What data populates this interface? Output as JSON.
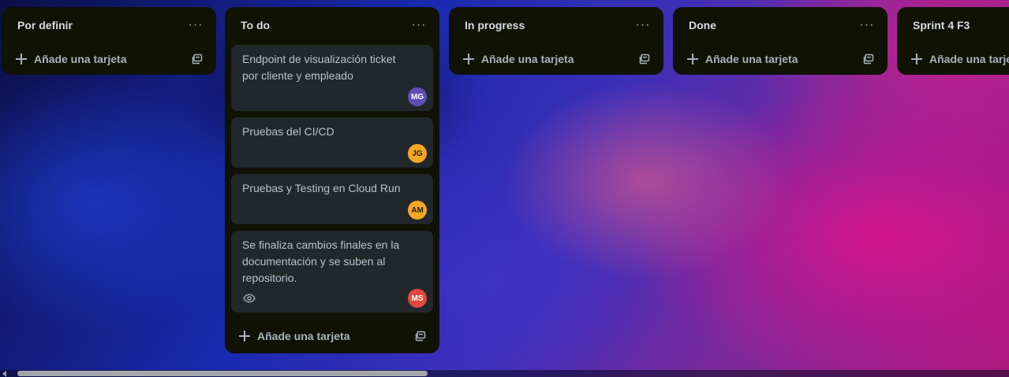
{
  "lists": [
    {
      "title": "Por definir",
      "more_label": "···",
      "add_label": "Añade una tarjeta",
      "cards": []
    },
    {
      "title": "To do",
      "more_label": "···",
      "add_label": "Añade una tarjeta",
      "cards": [
        {
          "title": "Endpoint de visualización ticket por cliente y empleado",
          "member": "MG",
          "member_color": "#5e4db2",
          "watching": false
        },
        {
          "title": "Pruebas del CI/CD",
          "member": "JG",
          "member_color": "#f5a623",
          "watching": false
        },
        {
          "title": "Pruebas y Testing en Cloud Run",
          "member": "AM",
          "member_color": "#f5a623",
          "watching": false
        },
        {
          "title": "Se finaliza cambios finales en la documentación y se suben al repositorio.",
          "member": "MS",
          "member_color": "#e2483d",
          "watching": true
        }
      ]
    },
    {
      "title": "In progress",
      "more_label": "···",
      "add_label": "Añade una tarjeta",
      "cards": []
    },
    {
      "title": "Done",
      "more_label": "···",
      "add_label": "Añade una tarjeta",
      "cards": []
    },
    {
      "title": "Sprint 4 F3",
      "more_label": "···",
      "add_label": "Añade una tarjeta",
      "cards": []
    }
  ],
  "icons": {
    "more": "ellipsis-icon",
    "add": "plus-icon",
    "template": "card-template-icon",
    "watch": "eye-icon"
  }
}
